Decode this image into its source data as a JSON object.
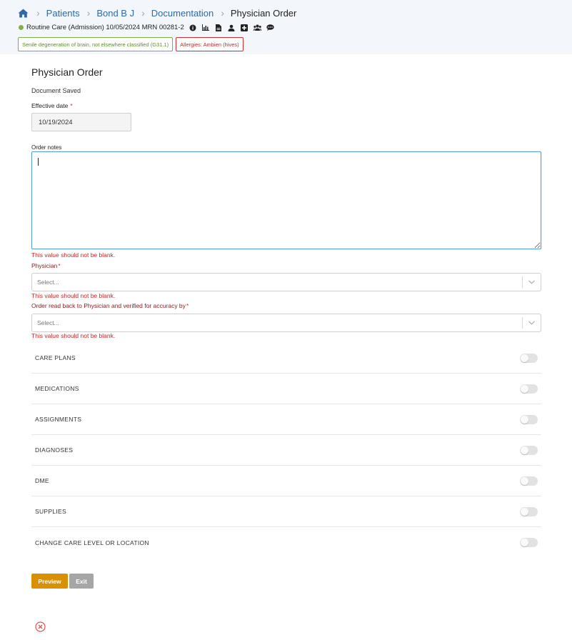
{
  "breadcrumb": {
    "items": [
      "Patients",
      "Bond B J",
      "Documentation"
    ],
    "current": "Physician Order"
  },
  "patient": {
    "info": "Routine Care (Admission) 10/05/2024 MRN 00281-2",
    "status_color": "#7cb342",
    "icons": [
      "info-icon",
      "chart-icon",
      "document-icon",
      "user-icon",
      "plus-square-icon",
      "group-icon",
      "chat-icon"
    ]
  },
  "badges": {
    "diagnosis": "Senile degeneration of brain, not elsewhere classified (G31.1)",
    "allergies": "Allergies: Ambien (hives)"
  },
  "form": {
    "title": "Physician Order",
    "doc_status": "Document Saved",
    "effective_date": {
      "label": "Effective date",
      "required": "*",
      "value": "10/19/2024"
    },
    "order_notes": {
      "label": "Order notes",
      "value": "",
      "error": "This value should not be blank."
    },
    "physician": {
      "label": "Physician",
      "required": "*",
      "placeholder": "Select...",
      "error": "This value should not be blank."
    },
    "verified_by": {
      "label": "Order read back to Physician and verified for accuracy by",
      "required": "*",
      "placeholder": "Select...",
      "error": "This value should not be blank."
    }
  },
  "sections": [
    {
      "label": "CARE PLANS",
      "enabled": false
    },
    {
      "label": "MEDICATIONS",
      "enabled": false
    },
    {
      "label": "ASSIGNMENTS",
      "enabled": false
    },
    {
      "label": "DIAGNOSES",
      "enabled": false
    },
    {
      "label": "DME",
      "enabled": false
    },
    {
      "label": "SUPPLIES",
      "enabled": false
    },
    {
      "label": "CHANGE CARE LEVEL OR LOCATION",
      "enabled": false
    }
  ],
  "buttons": {
    "preview": "Preview",
    "exit": "Exit"
  },
  "colors": {
    "accent": "#2d6aa6",
    "primary_button": "#d99103",
    "secondary_button": "#a6a6a6",
    "error": "#c62828"
  }
}
